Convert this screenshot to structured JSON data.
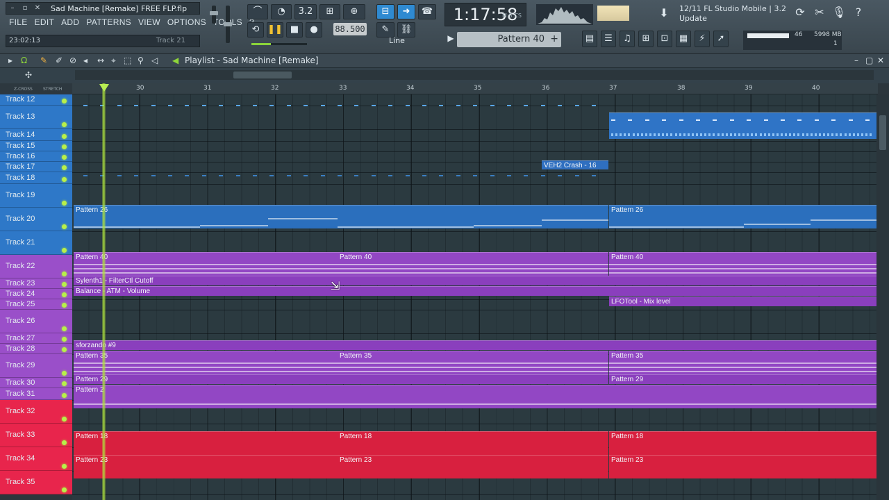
{
  "window": {
    "title": "Sad Machine [Remake] FREE FLP.flp",
    "elapsed_time": "23:02:13",
    "hint_track": "Track 21"
  },
  "menu": [
    "FILE",
    "EDIT",
    "ADD",
    "PATTERNS",
    "VIEW",
    "OPTIONS",
    "TOOLS",
    "?"
  ],
  "transport": {
    "mode_label": "3.2",
    "tempo": "88.500",
    "snap_label": "Line",
    "song_position": "1:17:58",
    "position_units": "M:S:CS",
    "pattern_selector": "Pattern 40"
  },
  "news": {
    "line1": "12/11  FL Studio Mobile | 3.2",
    "line2": "Update"
  },
  "meter": {
    "cpu": "46",
    "memory": "5998 MB",
    "voices": "1"
  },
  "playlist": {
    "title": "Playlist - Sad Machine [Remake]",
    "top_labels": [
      "Z-CROSS",
      "STRETCH"
    ],
    "bars": [
      "30",
      "31",
      "32",
      "33",
      "34",
      "35",
      "36",
      "37",
      "38",
      "39",
      "40"
    ]
  },
  "tracks": [
    {
      "name": "Track 12",
      "color": "#2e78c8"
    },
    {
      "name": "Track 13",
      "color": "#2e78c8"
    },
    {
      "name": "Track 14",
      "color": "#2e78c8"
    },
    {
      "name": "Track 15",
      "color": "#2e78c8"
    },
    {
      "name": "Track 16",
      "color": "#2e78c8"
    },
    {
      "name": "Track 17",
      "color": "#2e78c8"
    },
    {
      "name": "Track 18",
      "color": "#2e78c8"
    },
    {
      "name": "Track 19",
      "color": "#2e78c8"
    },
    {
      "name": "Track 20",
      "color": "#2e78c8"
    },
    {
      "name": "Track 21",
      "color": "#2e78c8"
    },
    {
      "name": "Track 22",
      "color": "#9a4fc9"
    },
    {
      "name": "Track 23",
      "color": "#9a4fc9"
    },
    {
      "name": "Track 24",
      "color": "#9a4fc9"
    },
    {
      "name": "Track 25",
      "color": "#9a4fc9"
    },
    {
      "name": "Track 26",
      "color": "#9a4fc9"
    },
    {
      "name": "Track 27",
      "color": "#9a4fc9"
    },
    {
      "name": "Track 28",
      "color": "#9a4fc9"
    },
    {
      "name": "Track 29",
      "color": "#9a4fc9"
    },
    {
      "name": "Track 30",
      "color": "#9a4fc9"
    },
    {
      "name": "Track 31",
      "color": "#9a4fc9"
    },
    {
      "name": "Track 32",
      "color": "#e8254c"
    },
    {
      "name": "Track 33",
      "color": "#e8254c"
    },
    {
      "name": "Track 34",
      "color": "#e8254c"
    },
    {
      "name": "Track 35",
      "color": "#e8254c"
    }
  ],
  "clips": {
    "veh2_crash": "VEH2 Crash - 16",
    "pattern26": "Pattern 26",
    "pattern40": "Pattern 40",
    "sylenth": "Sylenth1 - FilterCtl Cutoff",
    "balance": "Balance - ATM - Volume",
    "lfotool": "LFOTool - Mix level",
    "sforzando": "sforzando #9",
    "pattern35": "Pattern 35",
    "pattern29": "Pattern 29",
    "pattern2": "Pattern 2",
    "pattern18": "Pattern 18",
    "pattern23": "Pattern 23"
  }
}
